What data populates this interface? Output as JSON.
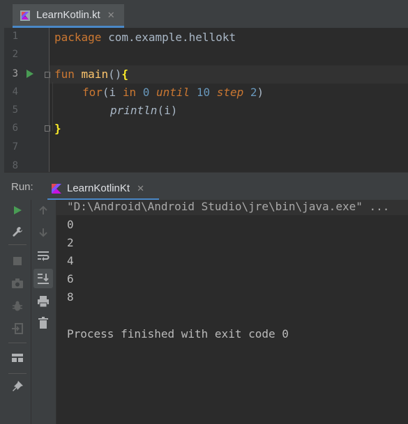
{
  "editor": {
    "tab_label": "LearnKotlin.kt",
    "tab_close": "✕",
    "line_numbers": [
      "1",
      "2",
      "3",
      "4",
      "5",
      "6",
      "7",
      "8"
    ],
    "lines": {
      "l1_kw": "package",
      "l1_rest": " com.example.hellokt",
      "l3_kw": "fun",
      "l3_fn": " main",
      "l3_paren": "()",
      "l3_brace": "{",
      "l4_kw": "for",
      "l4_open": "(i ",
      "l4_in": "in",
      "l4_zero": "0",
      "l4_until": "until",
      "l4_ten": "10",
      "l4_step": "step",
      "l4_two": "2",
      "l4_close": ")",
      "l5_fn": "println",
      "l5_args": "(i)",
      "l6_brace": "}"
    }
  },
  "run": {
    "label": "Run:",
    "tab_label": "LearnKotlinKt",
    "tab_close": "✕",
    "console": {
      "command": "\"D:\\Android\\Android Studio\\jre\\bin\\java.exe\" ...",
      "outputs": [
        "0",
        "2",
        "4",
        "6",
        "8"
      ],
      "finished": "Process finished with exit code 0"
    }
  },
  "colors": {
    "keyword": "#cc7832",
    "function": "#ffc66d",
    "number": "#6897bb",
    "run_green": "#499c54",
    "accent": "#4a88c7"
  },
  "icons": [
    "kotlin-file-icon",
    "run-icon",
    "wrench-icon",
    "stop-icon",
    "camera-icon",
    "debug-icon",
    "exit-icon",
    "layout-icon",
    "pin-icon",
    "up-arrow-icon",
    "down-arrow-icon",
    "soft-wrap-icon",
    "scroll-to-end-icon",
    "print-icon",
    "trash-icon"
  ]
}
